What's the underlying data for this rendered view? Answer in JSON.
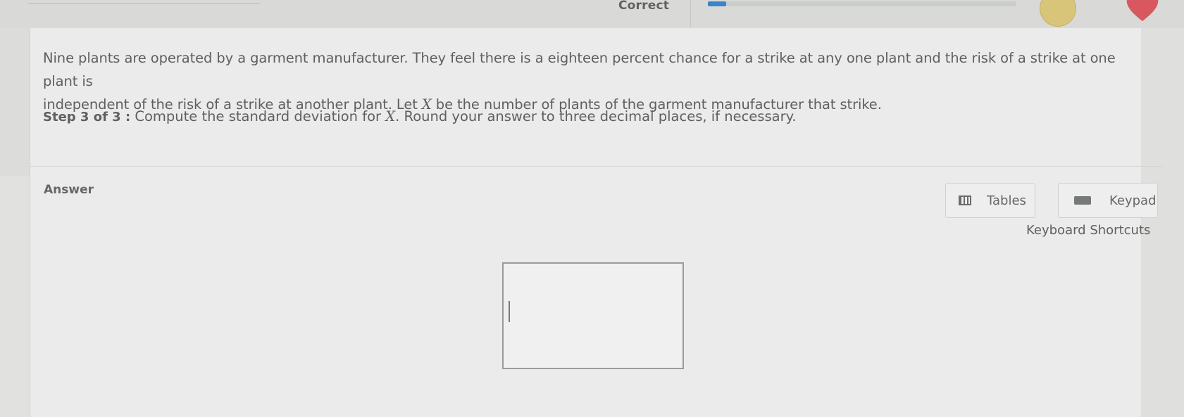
{
  "header": {
    "status_text": "Correct",
    "progress_fraction": 0.06,
    "colors": {
      "progress_fill": "#3c84c8",
      "gold_badge": "#d9c57a",
      "heart_badge": "#d9585f"
    }
  },
  "question": {
    "line1": "Nine plants are operated by a garment manufacturer. They feel there is a eighteen percent chance for a strike at any one plant and the risk of a strike at one plant is",
    "line2_before_var": "independent of the risk of a strike at another plant. Let ",
    "variable": "X",
    "line2_after_var": " be the number of plants of the garment manufacturer that strike."
  },
  "step": {
    "label": "Step 3 of 3 :",
    "text_before_var": " Compute the standard deviation for ",
    "variable": "X",
    "text_after_var": ". Round your answer to three decimal places, if necessary."
  },
  "answer": {
    "label": "Answer",
    "input_value": "",
    "input_placeholder": ""
  },
  "tools": {
    "tables_label": "Tables",
    "keypad_label": "Keypad",
    "keyboard_shortcuts_label": "Keyboard Shortcuts",
    "tables_icon": "table-icon",
    "keypad_icon": "keypad-icon"
  }
}
